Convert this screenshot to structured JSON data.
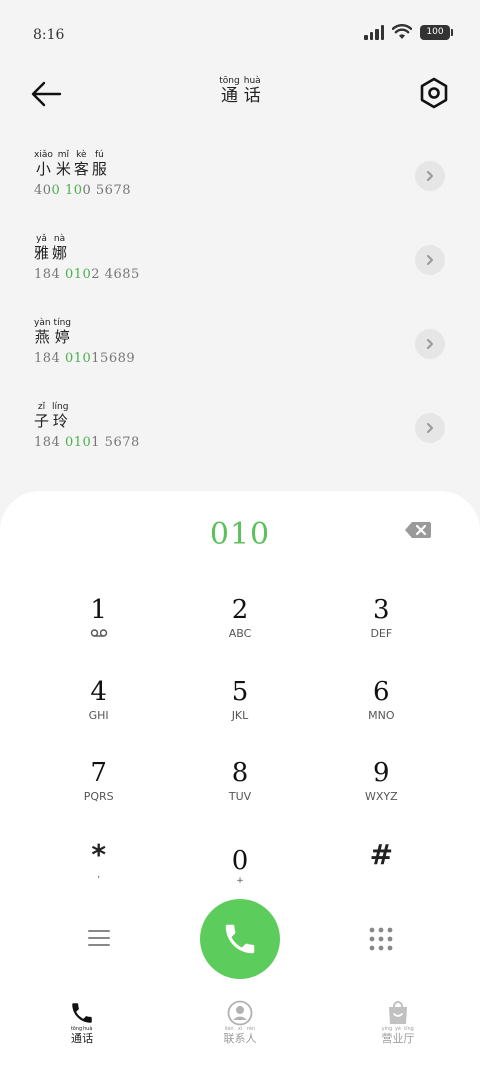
{
  "status": {
    "time": "8:16",
    "battery": "100"
  },
  "header": {
    "title": [
      {
        "han": "通",
        "py": "tōng"
      },
      {
        "han": "话",
        "py": "huà"
      }
    ]
  },
  "contacts": [
    {
      "name": [
        {
          "han": "小",
          "py": "xiǎo"
        },
        {
          "han": "米",
          "py": "mǐ"
        },
        {
          "han": "客",
          "py": "kè"
        },
        {
          "han": "服",
          "py": "fú"
        }
      ],
      "number": {
        "pre": "40",
        "hl": "0 10",
        "post": "0 5678"
      }
    },
    {
      "name": [
        {
          "han": "雅",
          "py": "yǎ"
        },
        {
          "han": "娜",
          "py": "nà"
        }
      ],
      "number": {
        "pre": "184 ",
        "hl": "010",
        "post": "2 4685"
      }
    },
    {
      "name": [
        {
          "han": "燕",
          "py": "yàn"
        },
        {
          "han": "婷",
          "py": "tíng"
        }
      ],
      "number": {
        "pre": "184 ",
        "hl": "010",
        "post": "15689"
      }
    },
    {
      "name": [
        {
          "han": "子",
          "py": "zǐ"
        },
        {
          "han": "玲",
          "py": "líng"
        }
      ],
      "number": {
        "pre": "184 ",
        "hl": "010",
        "post": "1 5678"
      }
    }
  ],
  "dialer": {
    "input": "010",
    "keys": [
      {
        "digit": "1",
        "letters": ""
      },
      {
        "digit": "2",
        "letters": "ABC"
      },
      {
        "digit": "3",
        "letters": "DEF"
      },
      {
        "digit": "4",
        "letters": "GHI"
      },
      {
        "digit": "5",
        "letters": "JKL"
      },
      {
        "digit": "6",
        "letters": "MNO"
      },
      {
        "digit": "7",
        "letters": "PQRS"
      },
      {
        "digit": "8",
        "letters": "TUV"
      },
      {
        "digit": "9",
        "letters": "WXYZ"
      },
      {
        "digit": "*",
        "letters": ","
      },
      {
        "digit": "0",
        "letters": "+"
      },
      {
        "digit": "#",
        "letters": ""
      }
    ]
  },
  "tabs": [
    {
      "icon": "phone-icon",
      "label": [
        {
          "han": "通",
          "py": "tōng"
        },
        {
          "han": "话",
          "py": "huà"
        }
      ]
    },
    {
      "icon": "contacts-icon",
      "label": [
        {
          "han": "联",
          "py": "lián"
        },
        {
          "han": "系",
          "py": "xì"
        },
        {
          "han": "人",
          "py": "rén"
        }
      ]
    },
    {
      "icon": "store-icon",
      "label": [
        {
          "han": "营",
          "py": "yíng"
        },
        {
          "han": "业",
          "py": "yè"
        },
        {
          "han": "厅",
          "py": "tīng"
        }
      ]
    }
  ],
  "colors": {
    "accent": "#5ccc5c",
    "highlight": "#4caf50",
    "background": "#f4f4f4"
  }
}
